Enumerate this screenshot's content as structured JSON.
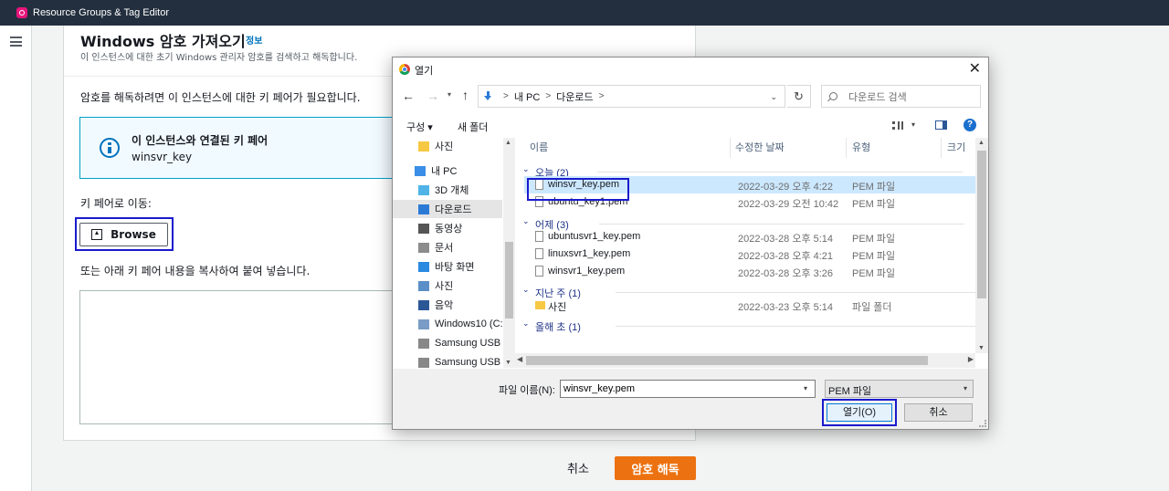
{
  "topbar": {
    "app_title": "Resource Groups & Tag Editor"
  },
  "page": {
    "title": "Windows 암호 가져오기",
    "info_link": "정보",
    "description": "이 인스턴스에 대한 초기 Windows 관리자 암호를 검색하고 해독합니다.",
    "need_key_text": "암호를 해독하려면 이 인스턴스에 대한 키 페어가 필요합니다.",
    "info_box": {
      "title": "이 인스턴스와 연결된 키 페어",
      "value": "winsvr_key"
    },
    "goto_label": "키 페어로 이동:",
    "browse_label": "Browse",
    "paste_label": "또는 아래 키 페어 내용을 복사하여 붙여 넣습니다.",
    "textarea_value": "",
    "cancel_label": "취소",
    "decrypt_label": "암호 해독"
  },
  "dialog": {
    "title": "열기",
    "close_glyph": "✕",
    "breadcrumb": [
      "내 PC",
      "다운로드"
    ],
    "search_placeholder": "다운로드 검색",
    "toolbar": {
      "organize": "구성 ▾",
      "new_folder": "새 폴더",
      "help": "?"
    },
    "nav_items": [
      {
        "label": "사진",
        "icon": "folder-icon",
        "color": "#f7c843"
      },
      {
        "label": "내 PC",
        "icon": "pc-icon",
        "color": "#3a8ee6"
      },
      {
        "label": "3D 개체",
        "icon": "3d-objects-icon",
        "color": "#4fb3e8"
      },
      {
        "label": "다운로드",
        "icon": "download-icon",
        "color": "#2b7bd6"
      },
      {
        "label": "동영상",
        "icon": "video-icon",
        "color": "#555555"
      },
      {
        "label": "문서",
        "icon": "document-icon",
        "color": "#8c8c8c"
      },
      {
        "label": "바탕 화면",
        "icon": "desktop-icon",
        "color": "#2b8ae0"
      },
      {
        "label": "사진",
        "icon": "pictures-icon",
        "color": "#5b8fc7"
      },
      {
        "label": "음악",
        "icon": "music-icon",
        "color": "#2b5797"
      },
      {
        "label": "Windows10 (C:)",
        "icon": "drive-icon",
        "color": "#7a9cc6"
      },
      {
        "label": "Samsung USB (D",
        "icon": "usb-icon",
        "color": "#888888"
      },
      {
        "label": "Samsung USB (D",
        "icon": "usb-icon",
        "color": "#888888"
      }
    ],
    "columns": {
      "name": "이름",
      "modified": "수정한 날짜",
      "type": "유형",
      "size": "크기"
    },
    "groups": [
      {
        "label": "오늘 (2)",
        "rows": [
          {
            "name": "winsvr_key.pem",
            "date": "2022-03-29 오후 4:22",
            "type": "PEM 파일",
            "selected": true
          },
          {
            "name": "ubuntu_key1.pem",
            "date": "2022-03-29 오전 10:42",
            "type": "PEM 파일"
          }
        ]
      },
      {
        "label": "어제 (3)",
        "rows": [
          {
            "name": "ubuntusvr1_key.pem",
            "date": "2022-03-28 오후 5:14",
            "type": "PEM 파일"
          },
          {
            "name": "linuxsvr1_key.pem",
            "date": "2022-03-28 오후 4:21",
            "type": "PEM 파일"
          },
          {
            "name": "winsvr1_key.pem",
            "date": "2022-03-28 오후 3:26",
            "type": "PEM 파일"
          }
        ]
      },
      {
        "label": "지난 주 (1)",
        "rows": [
          {
            "name": "사진",
            "date": "2022-03-23 오후 5:14",
            "type": "파일 폴더",
            "folder": true
          }
        ]
      },
      {
        "label": "올해 초 (1)",
        "rows": []
      }
    ],
    "filename_label": "파일 이름(N):",
    "filename_value": "winsvr_key.pem",
    "filetype_value": "PEM 파일",
    "open_label": "열기(O)",
    "cancel_label": "취소"
  },
  "colors": {
    "topbar": "#232f3e",
    "primary": "#ec7211",
    "link": "#0073bb",
    "highlight": "#1a1acd",
    "selection": "#cce8ff"
  }
}
